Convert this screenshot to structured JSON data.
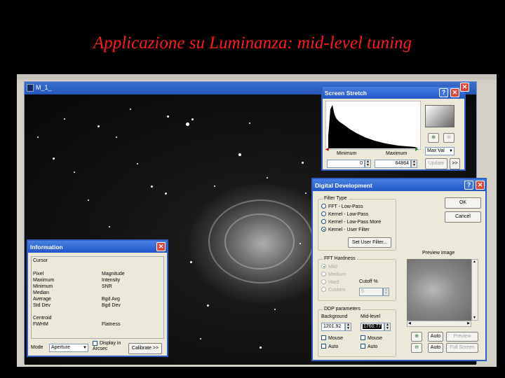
{
  "slide": {
    "title": "Applicazione  su Luminanza: mid-level tuning"
  },
  "image_window": {
    "title": "M_1_"
  },
  "screen_stretch": {
    "title": "Screen Stretch",
    "minimum_label": "Minimum",
    "maximum_label": "Maximum",
    "minimum_value": "0",
    "maximum_value": "64864",
    "mode_select": "Max Val",
    "update_button": "Update",
    "more_button": ">>"
  },
  "information": {
    "title": "Information",
    "cursor_label": "Cursor",
    "left_labels": [
      "Pixel",
      "Maximum",
      "Minimum",
      "Median",
      "Average",
      "Std Dev"
    ],
    "right_labels": [
      "Magnitude",
      "Intensity",
      "SNR",
      "",
      "Bgd Avg",
      "Bgd Dev"
    ],
    "centroid_label": "Centroid",
    "fwhm_label": "FWHM",
    "flatness_label": "Flatness",
    "mode_label": "Mode",
    "mode_value": "Aperture",
    "display_arcsec_label": "Display in Arcsec",
    "calibrate_button": "Calibrate >>"
  },
  "digital_development": {
    "title": "Digital Development",
    "filter_type_label": "Filter Type",
    "filter_options": [
      "FFT - Low-Pass",
      "Kernel - Low-Pass",
      "Kernel - Low-Pass More",
      "Kernel - User Filter"
    ],
    "selected_filter_index": 3,
    "set_user_filter_button": "Set User Filter...",
    "ok_button": "OK",
    "cancel_button": "Cancel",
    "preview_image_label": "Preview Image",
    "fft_hardness_label": "FFT Hardness",
    "hardness_options": [
      "Mild",
      "Medium",
      "Hard",
      "Custom"
    ],
    "cutoff_label": "Cutoff %",
    "cutoff_value": "5",
    "ddp_parameters_label": "DDP parameters",
    "background_label": "Background",
    "midlevel_label": "Mid-level",
    "background_value": "1201.92",
    "midlevel_value": "1760.77",
    "mouse_label": "Mouse",
    "auto_label": "Auto",
    "auto_button": "Auto",
    "preview_button": "Preview",
    "full_screen_button": "Full Screen"
  }
}
